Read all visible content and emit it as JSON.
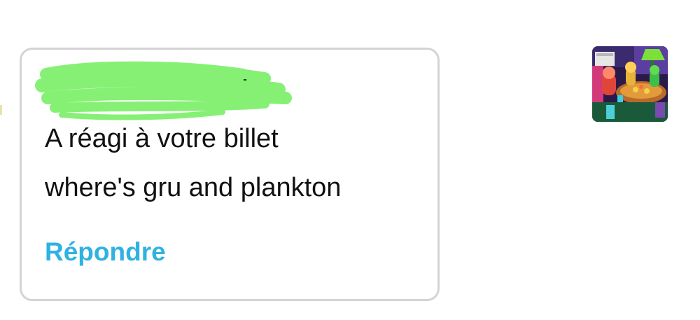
{
  "notification": {
    "action_text": "A réagi à votre billet",
    "reply_text": "where's gru and plankton",
    "reply_button_label": "Répondre",
    "username_redacted": true
  },
  "colors": {
    "card_border": "#d4d4d4",
    "accent_link": "#2fb2e2",
    "redaction": "#86f075",
    "text": "#111111"
  },
  "thumbnail": {
    "icon": "post-thumbnail-image"
  }
}
